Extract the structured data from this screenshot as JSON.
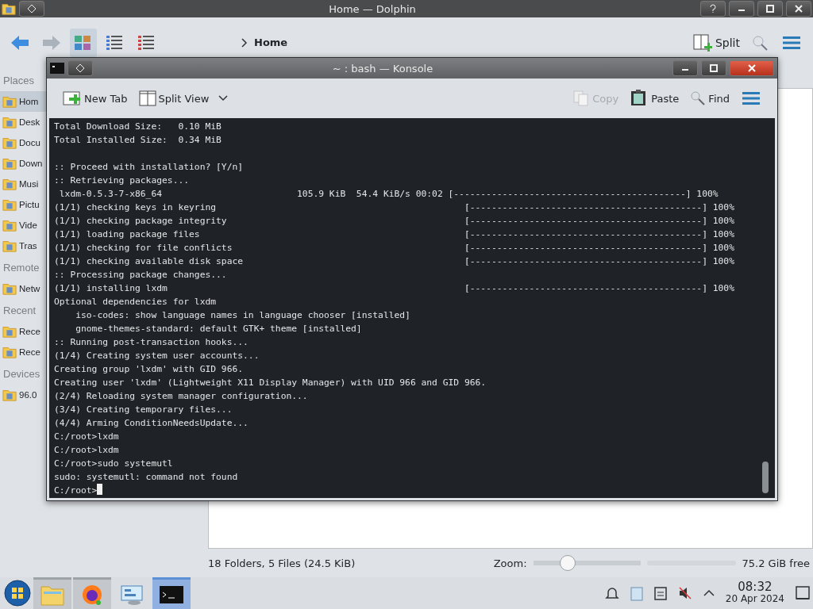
{
  "dolphin": {
    "title": "Home — Dolphin",
    "view_modes": [
      {
        "selected": true
      },
      {
        "selected": false
      },
      {
        "selected": false
      }
    ],
    "breadcrumb": "Home",
    "split_label": "Split",
    "places": [
      {
        "heading": "Places",
        "items": [
          {
            "label": "Hom",
            "selected": true
          },
          {
            "label": "Desk",
            "selected": false
          },
          {
            "label": "Docu",
            "selected": false
          },
          {
            "label": "Down",
            "selected": false
          },
          {
            "label": "Musi",
            "selected": false
          },
          {
            "label": "Pictu",
            "selected": false
          },
          {
            "label": "Vide",
            "selected": false
          },
          {
            "label": "Tras",
            "selected": false
          }
        ]
      },
      {
        "heading": "Remote",
        "items": [
          {
            "label": "Netw",
            "selected": false
          }
        ]
      },
      {
        "heading": "Recent",
        "items": [
          {
            "label": "Rece",
            "selected": false
          },
          {
            "label": "Rece",
            "selected": false
          }
        ]
      },
      {
        "heading": "Devices",
        "items": [
          {
            "label": "96.0",
            "selected": false
          }
        ]
      }
    ],
    "status": {
      "summary": "18 Folders, 5 Files (24.5 KiB)",
      "zoom_label": "Zoom:",
      "zoom": {
        "level": 0.29
      },
      "free": "75.2 GiB free"
    }
  },
  "konsole": {
    "title": "~ : bash — Konsole",
    "toolbar": [
      {
        "kind": "newtab",
        "label": "New Tab",
        "disabled": false
      },
      {
        "kind": "split",
        "label": "Split View",
        "disabled": false
      },
      {
        "kind": "copy",
        "label": "Copy",
        "disabled": true
      },
      {
        "kind": "paste",
        "label": "Paste",
        "disabled": false
      },
      {
        "kind": "find",
        "label": "Find",
        "disabled": false
      }
    ],
    "blocks": [
      [
        "Total Download Size:   0.10 MiB",
        "Total Installed Size:  0.34 MiB"
      ],
      [
        ":: Proceed with installation? [Y/n]",
        ":: Retrieving packages...",
        " lxdm-0.5.3-7-x86_64                         105.9 KiB  54.4 KiB/s 00:02 [-------------------------------------------] 100%",
        "(1/1) checking keys in keyring                                              [-------------------------------------------] 100%",
        "(1/1) checking package integrity                                            [-------------------------------------------] 100%",
        "(1/1) loading package files                                                 [-------------------------------------------] 100%",
        "(1/1) checking for file conflicts                                           [-------------------------------------------] 100%",
        "(1/1) checking available disk space                                         [-------------------------------------------] 100%",
        ":: Processing package changes...",
        "(1/1) installing lxdm                                                       [-------------------------------------------] 100%",
        "Optional dependencies for lxdm",
        "    iso-codes: show language names in language chooser [installed]",
        "    gnome-themes-standard: default GTK+ theme [installed]",
        ":: Running post-transaction hooks...",
        "(1/4) Creating system user accounts...",
        "Creating group 'lxdm' with GID 966.",
        "Creating user 'lxdm' (Lightweight X11 Display Manager) with UID 966 and GID 966.",
        "(2/4) Reloading system manager configuration...",
        "(3/4) Creating temporary files...",
        "(4/4) Arming ConditionNeedsUpdate...",
        "C:/root>lxdm",
        "C:/root>lxdm",
        "C:/root>sudo systemutl",
        "sudo: systemutl: command not found",
        "C:/root>"
      ]
    ]
  },
  "taskbar": {
    "tasks": [
      {
        "kind": "files",
        "open": true,
        "selected": false
      },
      {
        "kind": "browser",
        "open": true,
        "selected": false
      },
      {
        "kind": "settings",
        "open": false,
        "selected": false
      },
      {
        "kind": "terminal",
        "open": true,
        "selected": true
      }
    ],
    "clock": {
      "time": "08:32",
      "date": "20 Apr 2024"
    }
  }
}
